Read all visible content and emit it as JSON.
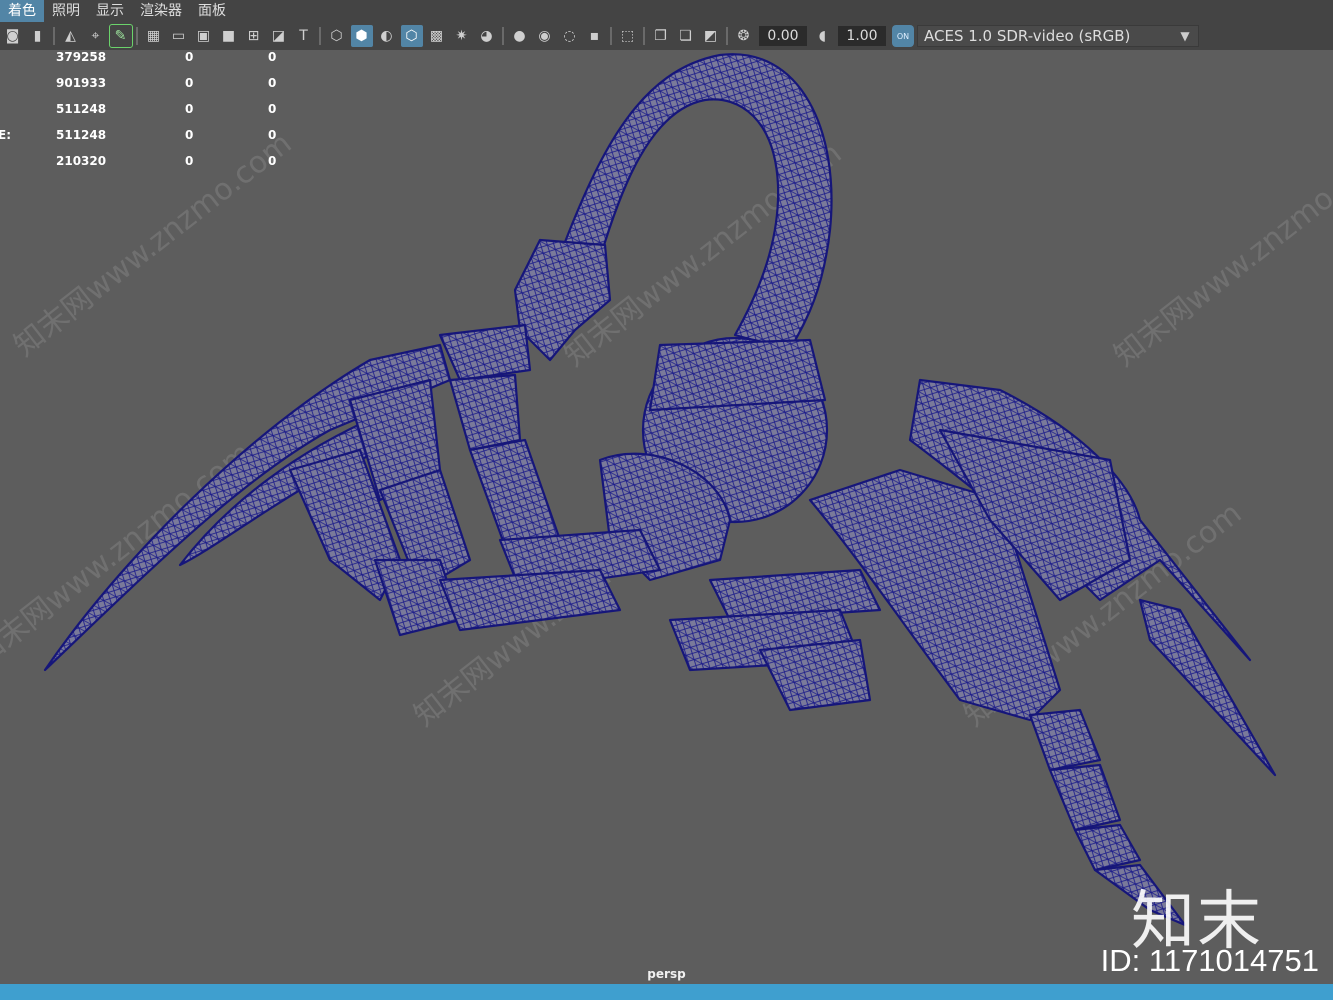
{
  "menu": {
    "items": [
      {
        "label": "着色",
        "active": true
      },
      {
        "label": "照明",
        "active": false
      },
      {
        "label": "显示",
        "active": false
      },
      {
        "label": "渲染器",
        "active": false
      },
      {
        "label": "面板",
        "active": false
      }
    ]
  },
  "toolbar": {
    "exposure_value": "0.00",
    "gamma_value": "1.00",
    "color_management_toggle": "ON",
    "color_space": "ACES 1.0 SDR-video (sRGB)"
  },
  "hud": {
    "rows": [
      {
        "label": "",
        "v1": "379258",
        "v2": "0",
        "v3": "0"
      },
      {
        "label": "",
        "v1": "901933",
        "v2": "0",
        "v3": "0"
      },
      {
        "label": "",
        "v1": "511248",
        "v2": "0",
        "v3": "0"
      },
      {
        "label": "E:",
        "v1": "511248",
        "v2": "0",
        "v3": "0"
      },
      {
        "label": "",
        "v1": "210320",
        "v2": "0",
        "v3": "0"
      }
    ]
  },
  "viewport": {
    "camera": "persp",
    "wireframe_color": "#1c1c8a",
    "shaded_color": "#7a7a9a"
  },
  "watermark": {
    "logo": "知末",
    "id": "ID: 1171014751",
    "diagonal_text": "知末网www.znzmo.com"
  },
  "colors": {
    "accent": "#5285a6",
    "status_bar": "#3f9fcf",
    "viewport_bg": "#5d5d5d"
  }
}
